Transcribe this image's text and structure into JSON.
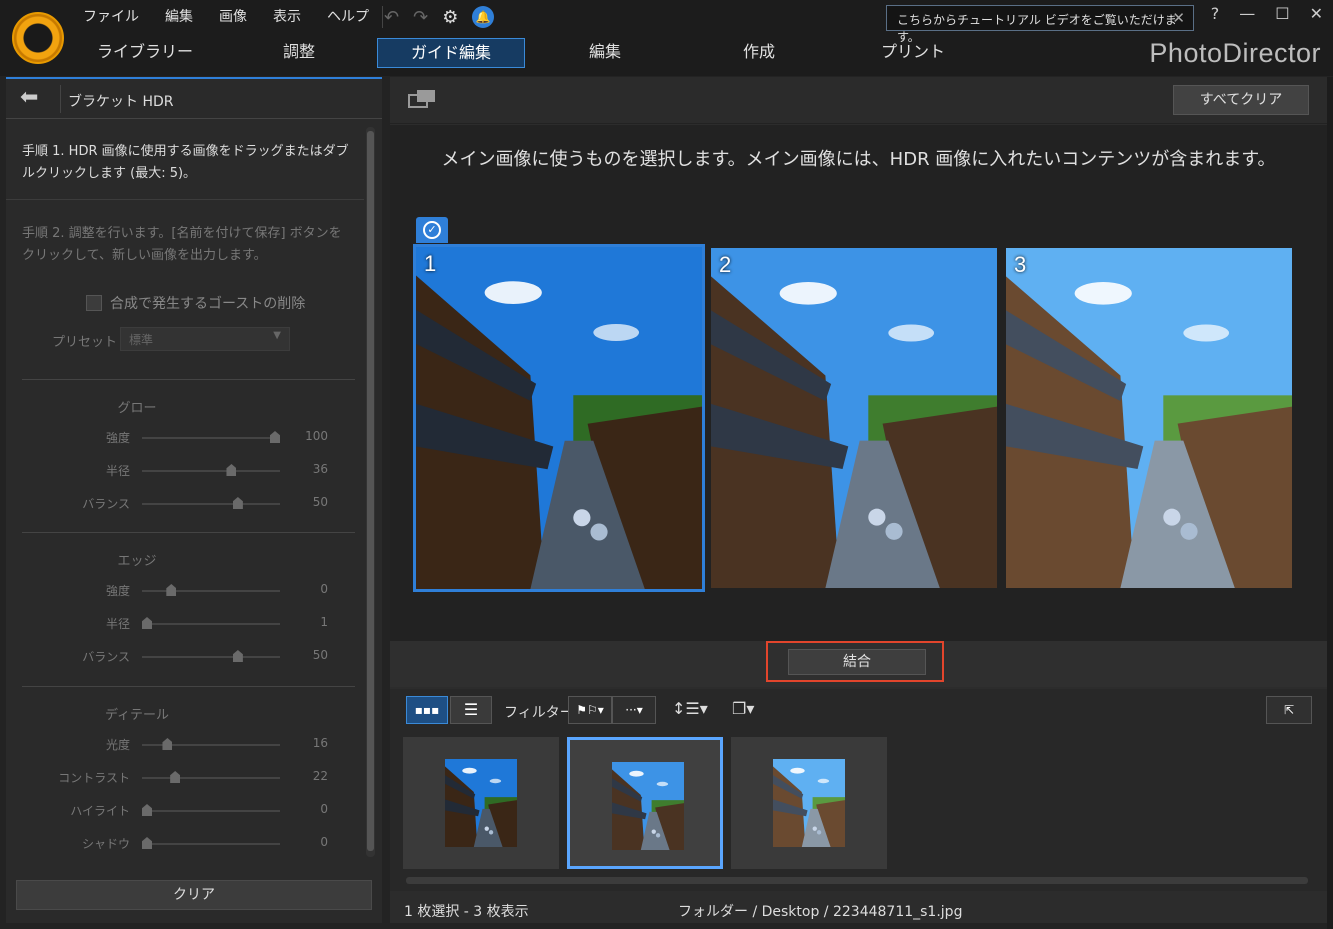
{
  "menu": [
    "ファイル",
    "編集",
    "画像",
    "表示",
    "ヘルプ"
  ],
  "notice": {
    "text": "こちらからチュートリアル ビデオをご覧いただけます。"
  },
  "window_controls": {
    "help": "?",
    "minimize": "—",
    "maximize": "☐",
    "close": "✕"
  },
  "tabs": [
    "ライブラリー",
    "調整",
    "ガイド編集",
    "編集",
    "作成",
    "プリント"
  ],
  "active_tab": "ガイド編集",
  "brand": "PhotoDirector",
  "left_panel": {
    "title": "ブラケット HDR",
    "step1": "手順 1. HDR 画像に使用する画像をドラッグまたはダブルクリックします (最大: 5)。",
    "step2": "手順 2. 調整を行います。[名前を付けて保存] ボタンをクリックして、新しい画像を出力します。",
    "ghost_label": "合成で発生するゴーストの削除",
    "preset_label": "プリセット",
    "preset_value": "標準",
    "sections": [
      {
        "title": "グロー",
        "sliders": [
          {
            "label": "強度",
            "value": "100",
            "level": 1.0
          },
          {
            "label": "半径",
            "value": "36",
            "level": 0.66
          },
          {
            "label": "バランス",
            "value": "50",
            "level": 0.71
          }
        ]
      },
      {
        "title": "エッジ",
        "sliders": [
          {
            "label": "強度",
            "value": "0",
            "level": 0.19
          },
          {
            "label": "半径",
            "value": "1",
            "level": 0.0
          },
          {
            "label": "バランス",
            "value": "50",
            "level": 0.71
          }
        ]
      },
      {
        "title": "ディテール",
        "sliders": [
          {
            "label": "光度",
            "value": "16",
            "level": 0.16
          },
          {
            "label": "コントラスト",
            "value": "22",
            "level": 0.22
          },
          {
            "label": "ハイライト",
            "value": "0",
            "level": 0.0
          },
          {
            "label": "シャドウ",
            "value": "0",
            "level": 0.0
          }
        ]
      }
    ],
    "clear_label": "クリア"
  },
  "main": {
    "clear_all_label": "すべてクリア",
    "instruction": "メイン画像に使うものを選択します。メイン画像には、HDR 画像に入れたいコンテンツが含まれます。",
    "photos": [
      {
        "number": "1",
        "brightness": "dark",
        "selected": true
      },
      {
        "number": "2",
        "brightness": "mid",
        "selected": false
      },
      {
        "number": "3",
        "brightness": "bright",
        "selected": false
      }
    ],
    "merge_label": "結合",
    "filter_label": "フィルター:",
    "status_left": "1 枚選択 - 3 枚表示",
    "status_right": "フォルダー / Desktop / 223448711_s1.jpg"
  },
  "colors": {
    "accent": "#2f7fd8",
    "highlight_frame": "#e2452c",
    "bg": "#232323"
  }
}
